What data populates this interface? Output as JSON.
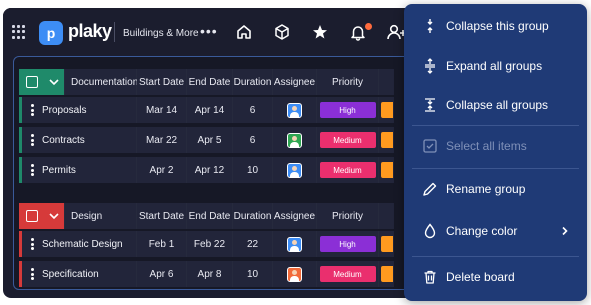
{
  "topbar": {
    "logo_letter": "p",
    "logo_text": "plaky",
    "workspace": "Buildings & More",
    "more": "•••",
    "icons": [
      "home-icon",
      "cube-icon",
      "star-icon",
      "bell-icon",
      "add-user-icon"
    ],
    "notification_color": "#ff6b3d"
  },
  "columns": [
    "Documentation",
    "Start Date",
    "End Date",
    "Duration",
    "Assignee",
    "Priority"
  ],
  "groups": [
    {
      "name": "Documentation",
      "color": "#1f8a6a",
      "headers": [
        "Documentation",
        "Start Date",
        "End Date",
        "Duration",
        "Assignee",
        "Priority"
      ],
      "rows": [
        {
          "task": "Proposals",
          "start": "Mar 14",
          "end": "Apr 14",
          "duration": "6",
          "priority": "High",
          "priority_color": "#8b2fd6",
          "avatar_color": "#3d8df5"
        },
        {
          "task": "Contracts",
          "start": "Mar 22",
          "end": "Apr 5",
          "duration": "6",
          "priority": "Medium",
          "priority_color": "#ea2f6e",
          "avatar_color": "#2fa653"
        },
        {
          "task": "Permits",
          "start": "Apr 2",
          "end": "Apr 12",
          "duration": "10",
          "priority": "Medium",
          "priority_color": "#ea2f6e",
          "avatar_color": "#3d8df5"
        }
      ]
    },
    {
      "name": "Design",
      "color": "#d63a3a",
      "headers": [
        "Design",
        "Start Date",
        "End Date",
        "Duration",
        "Assignee",
        "Priority"
      ],
      "rows": [
        {
          "task": "Schematic Design",
          "start": "Feb 1",
          "end": "Feb 22",
          "duration": "22",
          "priority": "High",
          "priority_color": "#8b2fd6",
          "avatar_color": "#3d8df5"
        },
        {
          "task": "Specification",
          "start": "Apr 6",
          "end": "Apr 8",
          "duration": "10",
          "priority": "Medium",
          "priority_color": "#ea2f6e",
          "avatar_color": "#f26a3a"
        }
      ]
    }
  ],
  "menu": {
    "items": [
      {
        "label": "Collapse this group",
        "icon": "collapse-group-icon",
        "disabled": false
      },
      {
        "label": "Expand all groups",
        "icon": "expand-all-icon",
        "disabled": false
      },
      {
        "label": "Collapse all groups",
        "icon": "collapse-all-icon",
        "disabled": false
      },
      {
        "label": "Select all items",
        "icon": "checkbox-icon",
        "disabled": true
      },
      {
        "label": "Rename group",
        "icon": "pencil-icon",
        "disabled": false
      },
      {
        "label": "Change color",
        "icon": "droplet-icon",
        "disabled": false
      },
      {
        "label": "Delete board",
        "icon": "trash-icon",
        "disabled": false
      }
    ]
  }
}
